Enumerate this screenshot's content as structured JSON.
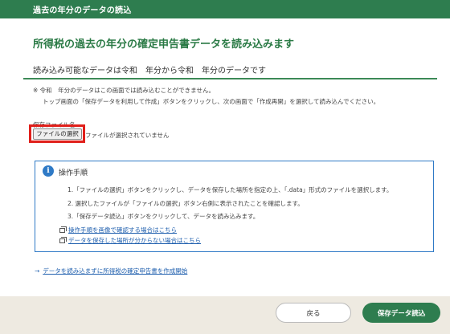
{
  "header": {
    "title": "過去の年分のデータの読込"
  },
  "main": {
    "page_title": "所得税の過去の年分の確定申告書データを読み込みます",
    "subheading": "読み込み可能なデータは令和　年分から令和　年分のデータです",
    "note_line1": "※ 令和　年分のデータはこの画面では読み込むことができません。",
    "note_line2": "トップ画面の「保存データを利用して作成」ボタンをクリックし、次の画面で「作成再開」を選択して読み込んでください。"
  },
  "file": {
    "label": "保存ファイル名",
    "button_label": "ファイルの選択",
    "status": "ファイルが選択されていません"
  },
  "info": {
    "icon": "i",
    "title": "操作手順",
    "steps": [
      "1.「ファイルの選択」ボタンをクリックし、データを保存した場所を指定の上、「.data」形式のファイルを選択します。",
      "2. 選択したファイルが「ファイルの選択」ボタン右側に表示されたことを確認します。",
      "3.「保存データ読込」ボタンをクリックして、データを読み込みます。"
    ],
    "links": [
      "操作手順を画像で確認する場合はこちら",
      "データを保存した場所が分からない場合はこちら"
    ]
  },
  "bottom_link": {
    "arrow": "→",
    "text": "データを読み込まずに所得税の確定申告書を作成開始"
  },
  "footer": {
    "back_label": "戻る",
    "load_label": "保存データ読込"
  },
  "colors": {
    "brand_green": "#2e7d4f",
    "highlight_red": "#e0201b",
    "info_blue": "#2f7ac6",
    "link_blue": "#1f5fae"
  }
}
